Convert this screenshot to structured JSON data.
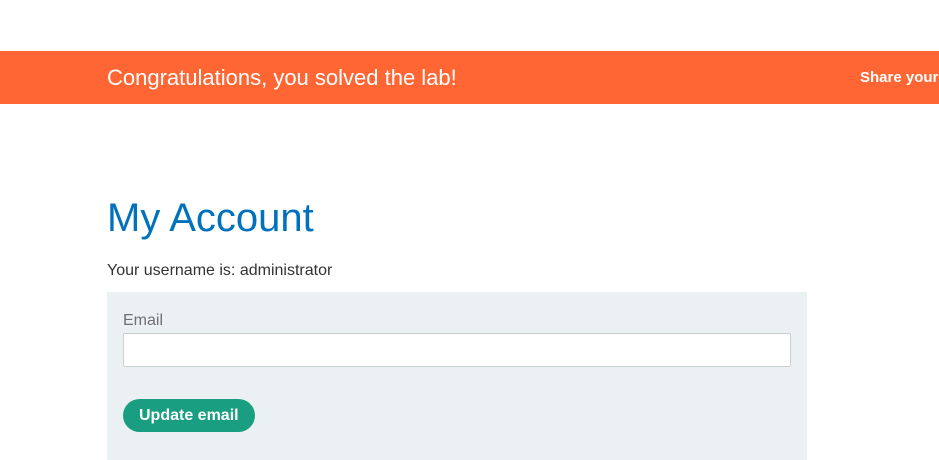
{
  "banner": {
    "message": "Congratulations, you solved the lab!",
    "share_label": "Share your",
    "background_color": "#ff6633"
  },
  "account": {
    "title": "My Account",
    "username_line": "Your username is: administrator"
  },
  "email_form": {
    "label": "Email",
    "value": "",
    "submit_label": "Update email",
    "button_color": "#1a9e81"
  }
}
